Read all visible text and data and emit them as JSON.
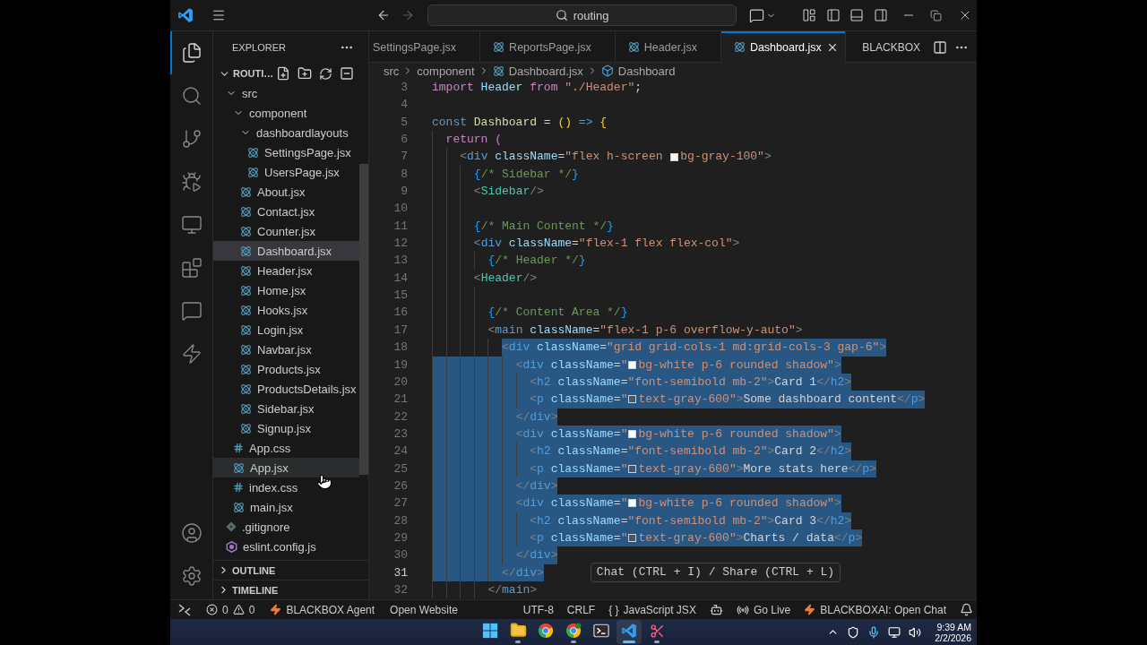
{
  "title_bar": {
    "nav": [
      {
        "kind": "back",
        "disabled": false
      },
      {
        "kind": "forward",
        "disabled": true
      }
    ],
    "command_center": "routing"
  },
  "activity_bar": {
    "top": [
      {
        "kind": "files",
        "selected": true
      },
      {
        "kind": "search",
        "selected": false
      },
      {
        "kind": "source-control",
        "selected": false
      },
      {
        "kind": "run-debug",
        "selected": false
      },
      {
        "kind": "remote",
        "selected": false
      },
      {
        "kind": "extensions",
        "selected": false
      },
      {
        "kind": "chat",
        "selected": false
      },
      {
        "kind": "blackbox",
        "selected": false
      }
    ],
    "bottom": [
      {
        "kind": "accounts",
        "selected": false
      },
      {
        "kind": "settings",
        "selected": false
      }
    ]
  },
  "sidebar": {
    "title": "EXPLORER",
    "project": {
      "name": "ROUTI…",
      "expanded": true
    },
    "tree": [
      {
        "label": "src",
        "kind": "folder",
        "expanded": true,
        "selected": false,
        "hovered": false,
        "children": [
          {
            "label": "component",
            "kind": "folder",
            "expanded": true,
            "selected": false,
            "hovered": false,
            "children": [
              {
                "label": "dashboardlayouts",
                "kind": "folder",
                "expanded": true,
                "selected": false,
                "hovered": false,
                "children": [
                  {
                    "label": "SettingsPage.jsx",
                    "kind": "jsx",
                    "selected": false,
                    "hovered": false
                  },
                  {
                    "label": "UsersPage.jsx",
                    "kind": "jsx",
                    "selected": false,
                    "hovered": false
                  }
                ]
              },
              {
                "label": "About.jsx",
                "kind": "jsx",
                "selected": false,
                "hovered": false
              },
              {
                "label": "Contact.jsx",
                "kind": "jsx",
                "selected": false,
                "hovered": false
              },
              {
                "label": "Counter.jsx",
                "kind": "jsx",
                "selected": false,
                "hovered": false
              },
              {
                "label": "Dashboard.jsx",
                "kind": "jsx",
                "selected": true,
                "hovered": false
              },
              {
                "label": "Header.jsx",
                "kind": "jsx",
                "selected": false,
                "hovered": false
              },
              {
                "label": "Home.jsx",
                "kind": "jsx",
                "selected": false,
                "hovered": false
              },
              {
                "label": "Hooks.jsx",
                "kind": "jsx",
                "selected": false,
                "hovered": false
              },
              {
                "label": "Login.jsx",
                "kind": "jsx",
                "selected": false,
                "hovered": false
              },
              {
                "label": "Navbar.jsx",
                "kind": "jsx",
                "selected": false,
                "hovered": false
              },
              {
                "label": "Products.jsx",
                "kind": "jsx",
                "selected": false,
                "hovered": false
              },
              {
                "label": "ProductsDetails.jsx",
                "kind": "jsx",
                "selected": false,
                "hovered": false
              },
              {
                "label": "Sidebar.jsx",
                "kind": "jsx",
                "selected": false,
                "hovered": false
              },
              {
                "label": "Signup.jsx",
                "kind": "jsx",
                "selected": false,
                "hovered": false
              }
            ]
          },
          {
            "label": "App.css",
            "kind": "css",
            "selected": false,
            "hovered": false
          },
          {
            "label": "App.jsx",
            "kind": "jsx",
            "selected": false,
            "hovered": true
          },
          {
            "label": "index.css",
            "kind": "css",
            "selected": false,
            "hovered": false
          },
          {
            "label": "main.jsx",
            "kind": "jsx",
            "selected": false,
            "hovered": false
          }
        ]
      },
      {
        "label": ".gitignore",
        "kind": "git",
        "selected": false,
        "hovered": false
      },
      {
        "label": "eslint.config.js",
        "kind": "eslint",
        "selected": false,
        "hovered": false
      }
    ],
    "sections": [
      {
        "label": "OUTLINE",
        "expanded": false
      },
      {
        "label": "TIMELINE",
        "expanded": false
      }
    ]
  },
  "editor": {
    "tabs": [
      {
        "label": "SettingsPage.jsx",
        "selected": false,
        "clipped": true
      },
      {
        "label": "ReportsPage.jsx",
        "selected": false,
        "clipped": false
      },
      {
        "label": "Header.jsx",
        "selected": false,
        "clipped": false
      },
      {
        "label": "Dashboard.jsx",
        "selected": true,
        "clipped": false
      }
    ],
    "toolbar_label": "BLACKBOX",
    "breadcrumbs": [
      {
        "label": "src",
        "kind": "folder"
      },
      {
        "label": "component",
        "kind": "folder"
      },
      {
        "label": "Dashboard.jsx",
        "kind": "jsx"
      },
      {
        "label": "Dashboard",
        "kind": "symbol"
      }
    ],
    "lines": [
      {
        "number": "3",
        "selected": false,
        "current": false,
        "tokens": [
          {
            "kind": "keyword",
            "text": "import"
          },
          {
            "kind": "variable",
            "text": " Header"
          },
          {
            "kind": "keyword",
            "text": " from"
          },
          {
            "kind": "string",
            "text": " \"./Header\""
          },
          {
            "kind": "operator",
            "text": ";"
          }
        ]
      },
      {
        "number": "4",
        "selected": false,
        "current": false
      },
      {
        "number": "5",
        "selected": false,
        "current": false,
        "tokens": [
          {
            "kind": "storage",
            "text": "const"
          },
          {
            "kind": "function",
            "text": " Dashboard"
          },
          {
            "kind": "operator",
            "text": " ="
          },
          {
            "kind": "bracket",
            "text": " ()"
          },
          {
            "kind": "arrow",
            "text": " =>"
          },
          {
            "kind": "bracket",
            "text": " {"
          }
        ]
      },
      {
        "number": "6",
        "selected": false,
        "current": false,
        "tokens": [
          {
            "kind": "keyword",
            "text": "  return"
          },
          {
            "kind": "paren",
            "text": " ("
          }
        ]
      },
      {
        "number": "7",
        "selected": false,
        "current": false,
        "tokens": [
          {
            "kind": "punct",
            "text": "    <"
          },
          {
            "kind": "tag",
            "text": "div"
          },
          {
            "kind": "attribute",
            "text": " className"
          },
          {
            "kind": "operator",
            "text": "="
          },
          {
            "kind": "string",
            "text": "\"flex h-screen "
          },
          {
            "kind": "swatch",
            "color": "#f3f4f6"
          },
          {
            "kind": "string",
            "text": "bg-gray-100\""
          },
          {
            "kind": "punct",
            "text": ">"
          }
        ]
      },
      {
        "number": "8",
        "selected": false,
        "current": false,
        "tokens": [
          {
            "kind": "brace",
            "text": "      {"
          },
          {
            "kind": "comment",
            "text": "/* Sidebar */"
          },
          {
            "kind": "brace",
            "text": "}"
          }
        ]
      },
      {
        "number": "9",
        "selected": false,
        "current": false,
        "tokens": [
          {
            "kind": "punct",
            "text": "      <"
          },
          {
            "kind": "component",
            "text": "Sidebar"
          },
          {
            "kind": "punct",
            "text": "/>"
          }
        ]
      },
      {
        "number": "10",
        "selected": false,
        "current": false
      },
      {
        "number": "11",
        "selected": false,
        "current": false,
        "tokens": [
          {
            "kind": "brace",
            "text": "      {"
          },
          {
            "kind": "comment",
            "text": "/* Main Content */"
          },
          {
            "kind": "brace",
            "text": "}"
          }
        ]
      },
      {
        "number": "12",
        "selected": false,
        "current": false,
        "tokens": [
          {
            "kind": "punct",
            "text": "      <"
          },
          {
            "kind": "tag",
            "text": "div"
          },
          {
            "kind": "attribute",
            "text": " className"
          },
          {
            "kind": "operator",
            "text": "="
          },
          {
            "kind": "string",
            "text": "\"flex-1 flex flex-col\""
          },
          {
            "kind": "punct",
            "text": ">"
          }
        ]
      },
      {
        "number": "13",
        "selected": false,
        "current": false,
        "tokens": [
          {
            "kind": "brace",
            "text": "        {"
          },
          {
            "kind": "comment",
            "text": "/* Header */"
          },
          {
            "kind": "brace",
            "text": "}"
          }
        ]
      },
      {
        "number": "14",
        "selected": false,
        "current": false,
        "tokens": [
          {
            "kind": "punct",
            "text": "      <"
          },
          {
            "kind": "component",
            "text": "Header"
          },
          {
            "kind": "punct",
            "text": "/>"
          }
        ]
      },
      {
        "number": "15",
        "selected": false,
        "current": false
      },
      {
        "number": "16",
        "selected": false,
        "current": false,
        "tokens": [
          {
            "kind": "brace",
            "text": "        {"
          },
          {
            "kind": "comment",
            "text": "/* Content Area */"
          },
          {
            "kind": "brace",
            "text": "}"
          }
        ]
      },
      {
        "number": "17",
        "selected": false,
        "current": false,
        "tokens": [
          {
            "kind": "punct",
            "text": "        <"
          },
          {
            "kind": "tag",
            "text": "main"
          },
          {
            "kind": "attribute",
            "text": " className"
          },
          {
            "kind": "operator",
            "text": "="
          },
          {
            "kind": "string",
            "text": "\"flex-1 p-6 overflow-y-auto\""
          },
          {
            "kind": "punct",
            "text": ">"
          }
        ]
      },
      {
        "number": "18",
        "selected": true,
        "current": false,
        "tokens": [
          {
            "kind": "punct",
            "text": "          <"
          },
          {
            "kind": "tag",
            "text": "div"
          },
          {
            "kind": "attribute",
            "text": " className"
          },
          {
            "kind": "operator",
            "text": "="
          },
          {
            "kind": "string",
            "text": "\"grid grid-cols-1 md:grid-cols-3 gap-6\""
          },
          {
            "kind": "punct",
            "text": ">"
          }
        ]
      },
      {
        "number": "19",
        "selected": true,
        "current": false,
        "tokens": [
          {
            "kind": "punct",
            "text": "            <"
          },
          {
            "kind": "tag",
            "text": "div"
          },
          {
            "kind": "attribute",
            "text": " className"
          },
          {
            "kind": "operator",
            "text": "="
          },
          {
            "kind": "string",
            "text": "\""
          },
          {
            "kind": "swatch",
            "color": "#ffffff"
          },
          {
            "kind": "string",
            "text": "bg-white p-6 rounded shadow\""
          },
          {
            "kind": "punct",
            "text": ">"
          }
        ]
      },
      {
        "number": "20",
        "selected": true,
        "current": false,
        "tokens": [
          {
            "kind": "punct",
            "text": "              <"
          },
          {
            "kind": "tag",
            "text": "h2"
          },
          {
            "kind": "attribute",
            "text": " className"
          },
          {
            "kind": "operator",
            "text": "="
          },
          {
            "kind": "string",
            "text": "\"font-semibold mb-2\""
          },
          {
            "kind": "punct",
            "text": ">"
          },
          {
            "kind": "text",
            "text": "Card 1"
          },
          {
            "kind": "punct",
            "text": "</"
          },
          {
            "kind": "tag",
            "text": "h2"
          },
          {
            "kind": "punct",
            "text": ">"
          }
        ]
      },
      {
        "number": "21",
        "selected": true,
        "current": false,
        "tokens": [
          {
            "kind": "punct",
            "text": "              <"
          },
          {
            "kind": "tag",
            "text": "p"
          },
          {
            "kind": "attribute",
            "text": " className"
          },
          {
            "kind": "operator",
            "text": "="
          },
          {
            "kind": "string",
            "text": "\""
          },
          {
            "kind": "swatch",
            "color": "#4b5563"
          },
          {
            "kind": "string",
            "text": "text-gray-600\""
          },
          {
            "kind": "punct",
            "text": ">"
          },
          {
            "kind": "text",
            "text": "Some dashboard content"
          },
          {
            "kind": "punct",
            "text": "</"
          },
          {
            "kind": "tag",
            "text": "p"
          },
          {
            "kind": "punct",
            "text": ">"
          }
        ]
      },
      {
        "number": "22",
        "selected": true,
        "current": false,
        "tokens": [
          {
            "kind": "punct",
            "text": "            </"
          },
          {
            "kind": "tag",
            "text": "div"
          },
          {
            "kind": "punct",
            "text": ">"
          }
        ]
      },
      {
        "number": "23",
        "selected": true,
        "current": false,
        "tokens": [
          {
            "kind": "punct",
            "text": "            <"
          },
          {
            "kind": "tag",
            "text": "div"
          },
          {
            "kind": "attribute",
            "text": " className"
          },
          {
            "kind": "operator",
            "text": "="
          },
          {
            "kind": "string",
            "text": "\""
          },
          {
            "kind": "swatch",
            "color": "#ffffff"
          },
          {
            "kind": "string",
            "text": "bg-white p-6 rounded shadow\""
          },
          {
            "kind": "punct",
            "text": ">"
          }
        ]
      },
      {
        "number": "24",
        "selected": true,
        "current": false,
        "tokens": [
          {
            "kind": "punct",
            "text": "              <"
          },
          {
            "kind": "tag",
            "text": "h2"
          },
          {
            "kind": "attribute",
            "text": " className"
          },
          {
            "kind": "operator",
            "text": "="
          },
          {
            "kind": "string",
            "text": "\"font-semibold mb-2\""
          },
          {
            "kind": "punct",
            "text": ">"
          },
          {
            "kind": "text",
            "text": "Card 2"
          },
          {
            "kind": "punct",
            "text": "</"
          },
          {
            "kind": "tag",
            "text": "h2"
          },
          {
            "kind": "punct",
            "text": ">"
          }
        ]
      },
      {
        "number": "25",
        "selected": true,
        "current": false,
        "tokens": [
          {
            "kind": "punct",
            "text": "              <"
          },
          {
            "kind": "tag",
            "text": "p"
          },
          {
            "kind": "attribute",
            "text": " className"
          },
          {
            "kind": "operator",
            "text": "="
          },
          {
            "kind": "string",
            "text": "\""
          },
          {
            "kind": "swatch",
            "color": "#4b5563"
          },
          {
            "kind": "string",
            "text": "text-gray-600\""
          },
          {
            "kind": "punct",
            "text": ">"
          },
          {
            "kind": "text",
            "text": "More stats here"
          },
          {
            "kind": "punct",
            "text": "</"
          },
          {
            "kind": "tag",
            "text": "p"
          },
          {
            "kind": "punct",
            "text": ">"
          }
        ]
      },
      {
        "number": "26",
        "selected": true,
        "current": false,
        "tokens": [
          {
            "kind": "punct",
            "text": "            </"
          },
          {
            "kind": "tag",
            "text": "div"
          },
          {
            "kind": "punct",
            "text": ">"
          }
        ]
      },
      {
        "number": "27",
        "selected": true,
        "current": false,
        "tokens": [
          {
            "kind": "punct",
            "text": "            <"
          },
          {
            "kind": "tag",
            "text": "div"
          },
          {
            "kind": "attribute",
            "text": " className"
          },
          {
            "kind": "operator",
            "text": "="
          },
          {
            "kind": "string",
            "text": "\""
          },
          {
            "kind": "swatch",
            "color": "#ffffff"
          },
          {
            "kind": "string",
            "text": "bg-white p-6 rounded shadow\""
          },
          {
            "kind": "punct",
            "text": ">"
          }
        ]
      },
      {
        "number": "28",
        "selected": true,
        "current": false,
        "tokens": [
          {
            "kind": "punct",
            "text": "              <"
          },
          {
            "kind": "tag",
            "text": "h2"
          },
          {
            "kind": "attribute",
            "text": " className"
          },
          {
            "kind": "operator",
            "text": "="
          },
          {
            "kind": "string",
            "text": "\"font-semibold mb-2\""
          },
          {
            "kind": "punct",
            "text": ">"
          },
          {
            "kind": "text",
            "text": "Card 3"
          },
          {
            "kind": "punct",
            "text": "</"
          },
          {
            "kind": "tag",
            "text": "h2"
          },
          {
            "kind": "punct",
            "text": ">"
          }
        ]
      },
      {
        "number": "29",
        "selected": true,
        "current": false,
        "tokens": [
          {
            "kind": "punct",
            "text": "              <"
          },
          {
            "kind": "tag",
            "text": "p"
          },
          {
            "kind": "attribute",
            "text": " className"
          },
          {
            "kind": "operator",
            "text": "="
          },
          {
            "kind": "string",
            "text": "\""
          },
          {
            "kind": "swatch",
            "color": "#4b5563"
          },
          {
            "kind": "string",
            "text": "text-gray-600\""
          },
          {
            "kind": "punct",
            "text": ">"
          },
          {
            "kind": "text",
            "text": "Charts / data"
          },
          {
            "kind": "punct",
            "text": "</"
          },
          {
            "kind": "tag",
            "text": "p"
          },
          {
            "kind": "punct",
            "text": ">"
          }
        ]
      },
      {
        "number": "30",
        "selected": true,
        "current": false,
        "tokens": [
          {
            "kind": "punct",
            "text": "            </"
          },
          {
            "kind": "tag",
            "text": "div"
          },
          {
            "kind": "punct",
            "text": ">"
          }
        ]
      },
      {
        "number": "31",
        "selected": true,
        "current": true,
        "tokens": [
          {
            "kind": "punct",
            "text": "          </"
          },
          {
            "kind": "tag",
            "text": "div"
          },
          {
            "kind": "punct",
            "text": ">"
          }
        ],
        "hint": "Chat (CTRL + I) / Share (CTRL + L)"
      },
      {
        "number": "32",
        "selected": false,
        "current": false,
        "tokens": [
          {
            "kind": "punct",
            "text": "        </"
          },
          {
            "kind": "tag",
            "text": "main"
          },
          {
            "kind": "punct",
            "text": ">"
          }
        ]
      }
    ]
  },
  "status_bar": {
    "left": [
      {
        "kind": "remote"
      },
      {
        "kind": "problems",
        "errors": "0",
        "warnings": "0"
      },
      {
        "kind": "agent",
        "label": "BLACKBOX Agent"
      },
      {
        "kind": "plain",
        "label": "Open Website"
      }
    ],
    "right": [
      {
        "kind": "plain",
        "label": "UTF-8"
      },
      {
        "kind": "plain",
        "label": "CRLF"
      },
      {
        "kind": "language",
        "glyph": "{ }",
        "label": "JavaScript JSX"
      },
      {
        "kind": "copilot"
      },
      {
        "kind": "live",
        "label": "Go Live"
      },
      {
        "kind": "agent",
        "label": "BLACKBOXAI: Open Chat"
      },
      {
        "kind": "bell"
      }
    ]
  },
  "taskbar": {
    "apps": [
      {
        "kind": "start",
        "selected": false,
        "running": false
      },
      {
        "kind": "files",
        "selected": false,
        "running": true
      },
      {
        "kind": "chrome",
        "selected": false,
        "running": false
      },
      {
        "kind": "chrome-profile",
        "selected": false,
        "running": true
      },
      {
        "kind": "terminal",
        "selected": false,
        "running": false
      },
      {
        "kind": "vscode",
        "selected": true,
        "running": true
      },
      {
        "kind": "snipping",
        "selected": false,
        "running": true
      }
    ],
    "time": "9:39 AM",
    "date": "2/2/2026"
  }
}
